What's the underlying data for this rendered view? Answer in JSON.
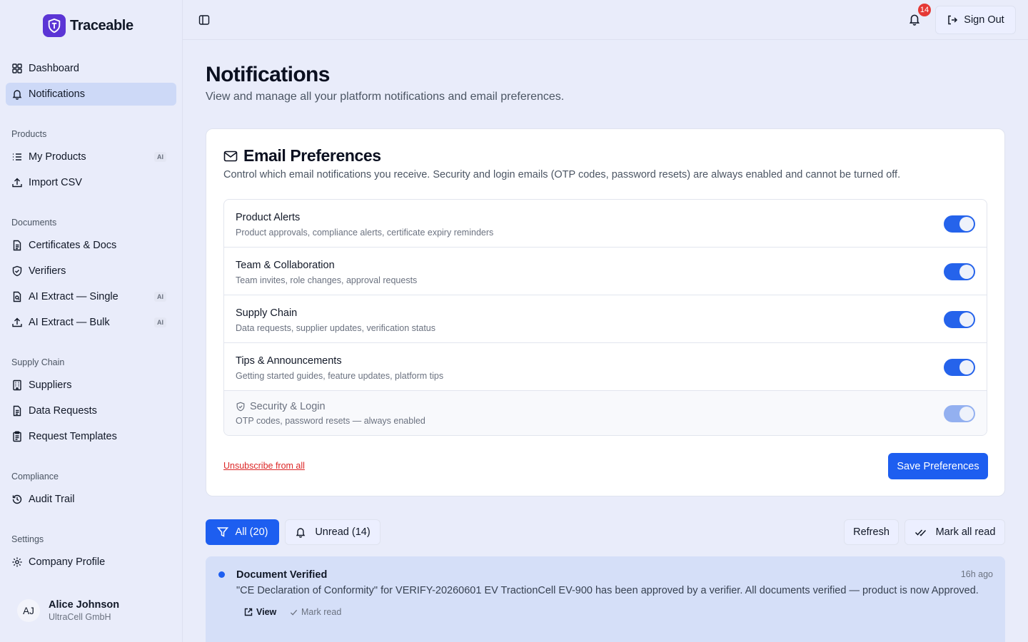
{
  "app": {
    "name": "Traceable"
  },
  "sidebar": {
    "top": [
      {
        "label": "Dashboard",
        "icon": "grid-icon"
      },
      {
        "label": "Notifications",
        "icon": "bell-icon",
        "active": true
      }
    ],
    "sections": [
      {
        "title": "Products",
        "items": [
          {
            "label": "My Products",
            "icon": "list-icon",
            "badge": "AI"
          },
          {
            "label": "Import CSV",
            "icon": "upload-icon"
          }
        ]
      },
      {
        "title": "Documents",
        "items": [
          {
            "label": "Certificates & Docs",
            "icon": "document-icon"
          },
          {
            "label": "Verifiers",
            "icon": "shield-icon"
          },
          {
            "label": "AI Extract — Single",
            "icon": "file-scan-icon",
            "badge": "AI"
          },
          {
            "label": "AI Extract — Bulk",
            "icon": "upload-icon",
            "badge": "AI"
          }
        ]
      },
      {
        "title": "Supply Chain",
        "items": [
          {
            "label": "Suppliers",
            "icon": "building-icon"
          },
          {
            "label": "Data Requests",
            "icon": "document-icon"
          },
          {
            "label": "Request Templates",
            "icon": "clipboard-icon"
          }
        ]
      },
      {
        "title": "Compliance",
        "items": [
          {
            "label": "Audit Trail",
            "icon": "history-icon"
          }
        ]
      },
      {
        "title": "Settings",
        "items": [
          {
            "label": "Company Profile",
            "icon": "gear-icon"
          }
        ]
      }
    ],
    "user": {
      "initials": "AJ",
      "name": "Alice Johnson",
      "org": "UltraCell GmbH"
    }
  },
  "topbar": {
    "notification_count": "14",
    "sign_out": "Sign Out"
  },
  "page": {
    "title": "Notifications",
    "subtitle": "View and manage all your platform notifications and email preferences."
  },
  "email_prefs": {
    "title": "Email Preferences",
    "description": "Control which email notifications you receive. Security and login emails (OTP codes, password resets) are always enabled and cannot be turned off.",
    "items": [
      {
        "label": "Product Alerts",
        "desc": "Product approvals, compliance alerts, certificate expiry reminders",
        "enabled": true
      },
      {
        "label": "Team & Collaboration",
        "desc": "Team invites, role changes, approval requests",
        "enabled": true
      },
      {
        "label": "Supply Chain",
        "desc": "Data requests, supplier updates, verification status",
        "enabled": true
      },
      {
        "label": "Tips & Announcements",
        "desc": "Getting started guides, feature updates, platform tips",
        "enabled": true
      },
      {
        "label": "Security & Login",
        "desc": "OTP codes, password resets — always enabled",
        "enabled": true,
        "locked": true
      }
    ],
    "unsubscribe": "Unsubscribe from all",
    "save": "Save Preferences"
  },
  "filters": {
    "all": "All (20)",
    "unread": "Unread (14)",
    "refresh": "Refresh",
    "mark_all": "Mark all read"
  },
  "notifications": [
    {
      "title": "Document Verified",
      "time": "16h ago",
      "body": "\"CE Declaration of Conformity\" for VERIFY-20260601 EV TractionCell EV-900 has been approved by a verifier. All documents verified — product is now Approved.",
      "view": "View",
      "mark_read": "Mark read",
      "unread": true
    }
  ],
  "colors": {
    "accent": "#1d5ef0",
    "brand": "#5b35d5",
    "danger": "#e53935"
  }
}
